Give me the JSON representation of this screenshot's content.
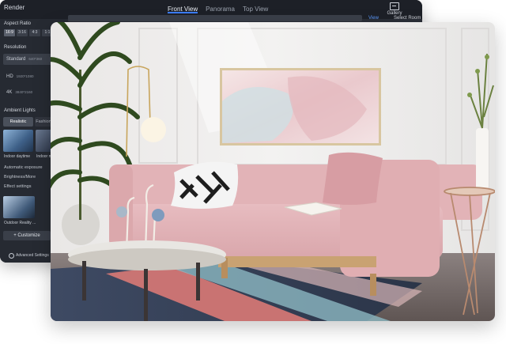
{
  "app": {
    "title": "Render",
    "tabs": [
      {
        "label": "Front View",
        "active": true
      },
      {
        "label": "Panorama",
        "active": false
      },
      {
        "label": "Top View",
        "active": false
      }
    ],
    "gallery_label": "Gallery",
    "view_label": "View",
    "select_room_label": "Select Room",
    "accent_color": "#3b7cff"
  },
  "sidebar": {
    "aspect_ratio": {
      "title": "Aspect Ratio",
      "options": [
        "16:9",
        "3:16",
        "4:3",
        "1:1"
      ],
      "selected": "16:9"
    },
    "resolution": {
      "title": "Resolution",
      "options": [
        {
          "label": "Standard",
          "size": "640*360",
          "selected": true
        },
        {
          "label": "HD",
          "size": "1920*1080",
          "selected": false
        },
        {
          "label": "4K",
          "size": "3840*2160",
          "selected": false
        }
      ]
    },
    "ambient_lights": {
      "title": "Ambient Lights",
      "modes": [
        "Realistic",
        "Fashion"
      ],
      "selected_mode": "Realistic",
      "presets": [
        {
          "label": "Indoor daytime",
          "icon": "daylight-thumbnail"
        },
        {
          "label": "Indoor n",
          "icon": "night-thumbnail"
        }
      ],
      "options": [
        "Automatic exposure",
        "Brightness/More",
        "Effect settings"
      ],
      "outdoor_preset": "Outdoor Reality ..."
    },
    "customize_label": "Customize",
    "advanced_settings_label": "Advanced Settings"
  },
  "render_view": {
    "scene": "living room render with pink sofa",
    "icons": [
      "potted-palm-icon",
      "floor-lamp-icon",
      "abstract-painting-icon",
      "pink-sofa-icon",
      "patterned-pillow-icon",
      "coffee-table-icon",
      "flamingo-sculpture-icon",
      "vase-branches-icon",
      "side-table-icon",
      "striped-rug-icon"
    ]
  }
}
